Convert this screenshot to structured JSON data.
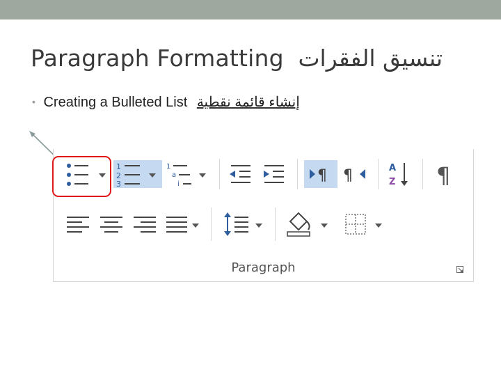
{
  "slide": {
    "title_en": "Paragraph Formatting",
    "title_ar": "تنسيق الفقرات",
    "bullet_en": "Creating a Bulleted List",
    "bullet_ar": "إنشاء قائمة نقطية"
  },
  "ribbon": {
    "group_label": "Paragraph",
    "buttons": [
      {
        "name": "bullets-button",
        "icon": "bulleted-list-icon",
        "highlighted": false,
        "has_dropdown": true
      },
      {
        "name": "numbering-button",
        "icon": "numbered-list-icon",
        "highlighted": true,
        "has_dropdown": true
      },
      {
        "name": "multilevel-list-button",
        "icon": "multilevel-list-icon",
        "highlighted": false,
        "has_dropdown": true
      },
      {
        "name": "decrease-indent-button",
        "icon": "decrease-indent-icon",
        "highlighted": false,
        "has_dropdown": false
      },
      {
        "name": "increase-indent-button",
        "icon": "increase-indent-icon",
        "highlighted": false,
        "has_dropdown": false
      },
      {
        "name": "ltr-direction-button",
        "icon": "left-to-right-icon",
        "highlighted": true,
        "has_dropdown": false
      },
      {
        "name": "rtl-direction-button",
        "icon": "right-to-left-icon",
        "highlighted": false,
        "has_dropdown": false
      },
      {
        "name": "sort-button",
        "icon": "sort-az-icon",
        "highlighted": false,
        "has_dropdown": false
      },
      {
        "name": "show-formatting-button",
        "icon": "pilcrow-icon",
        "highlighted": false,
        "has_dropdown": false
      },
      {
        "name": "align-left-button",
        "icon": "align-left-icon",
        "highlighted": false,
        "has_dropdown": false
      },
      {
        "name": "align-center-button",
        "icon": "align-center-icon",
        "highlighted": false,
        "has_dropdown": false
      },
      {
        "name": "align-right-button",
        "icon": "align-right-icon",
        "highlighted": false,
        "has_dropdown": false
      },
      {
        "name": "justify-button",
        "icon": "justify-icon",
        "highlighted": false,
        "has_dropdown": true
      },
      {
        "name": "line-spacing-button",
        "icon": "line-spacing-icon",
        "highlighted": false,
        "has_dropdown": true
      },
      {
        "name": "shading-button",
        "icon": "paint-bucket-icon",
        "highlighted": false,
        "has_dropdown": true
      },
      {
        "name": "borders-button",
        "icon": "borders-icon",
        "highlighted": false,
        "has_dropdown": true
      }
    ]
  },
  "colors": {
    "accent_highlight": "#c5d9f1",
    "callout_red": "#e01818",
    "header_bar": "#9ea89e",
    "bullet_dot_blue": "#2e5e9e"
  }
}
